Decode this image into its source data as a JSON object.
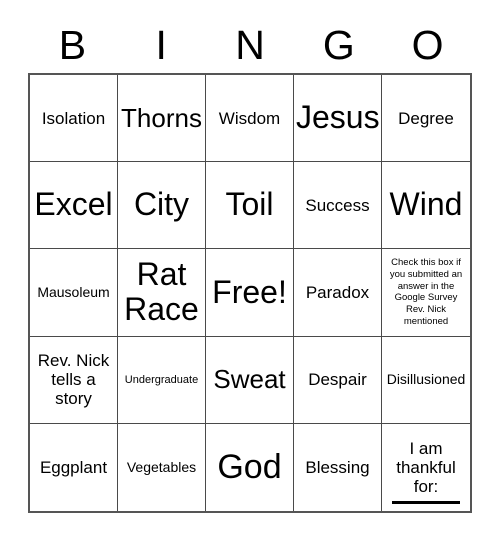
{
  "card": {
    "header_letters": [
      "B",
      "I",
      "N",
      "G",
      "O"
    ],
    "free_space_label": "Free!",
    "blank_line_present": true,
    "colors": {
      "background": "#ffffff",
      "text": "#000000",
      "grid_line": "#4a4a4a",
      "grid_border": "#555555"
    },
    "rows": [
      [
        {
          "text": "Isolation",
          "size": "md"
        },
        {
          "text": "Thorns",
          "size": "xl"
        },
        {
          "text": "Wisdom",
          "size": "md"
        },
        {
          "text": "Jesus",
          "size": "xxl"
        },
        {
          "text": "Degree",
          "size": "md"
        }
      ],
      [
        {
          "text": "Excel",
          "size": "xxl"
        },
        {
          "text": "City",
          "size": "xxl"
        },
        {
          "text": "Toil",
          "size": "xxl"
        },
        {
          "text": "Success",
          "size": "md"
        },
        {
          "text": "Wind",
          "size": "xxl"
        }
      ],
      [
        {
          "text": "Mausoleum",
          "size": "sm"
        },
        {
          "text": "Rat\nRace",
          "size": "xxl"
        },
        {
          "text": "Free!",
          "size": "xxl"
        },
        {
          "text": "Paradox",
          "size": "md"
        },
        {
          "text": "Check this box if you submitted an answer in the Google Survey Rev. Nick mentioned",
          "size": "xxs"
        }
      ],
      [
        {
          "text": "Rev. Nick tells a story",
          "size": "md"
        },
        {
          "text": "Undergraduate",
          "size": "xs"
        },
        {
          "text": "Sweat",
          "size": "xl"
        },
        {
          "text": "Despair",
          "size": "md"
        },
        {
          "text": "Disillusioned",
          "size": "sm"
        }
      ],
      [
        {
          "text": "Eggplant",
          "size": "md"
        },
        {
          "text": "Vegetables",
          "size": "sm"
        },
        {
          "text": "God",
          "size": "huge"
        },
        {
          "text": "Blessing",
          "size": "md"
        },
        {
          "text": "I am thankful for:",
          "size": "md",
          "has_blank_line": true
        }
      ]
    ]
  }
}
